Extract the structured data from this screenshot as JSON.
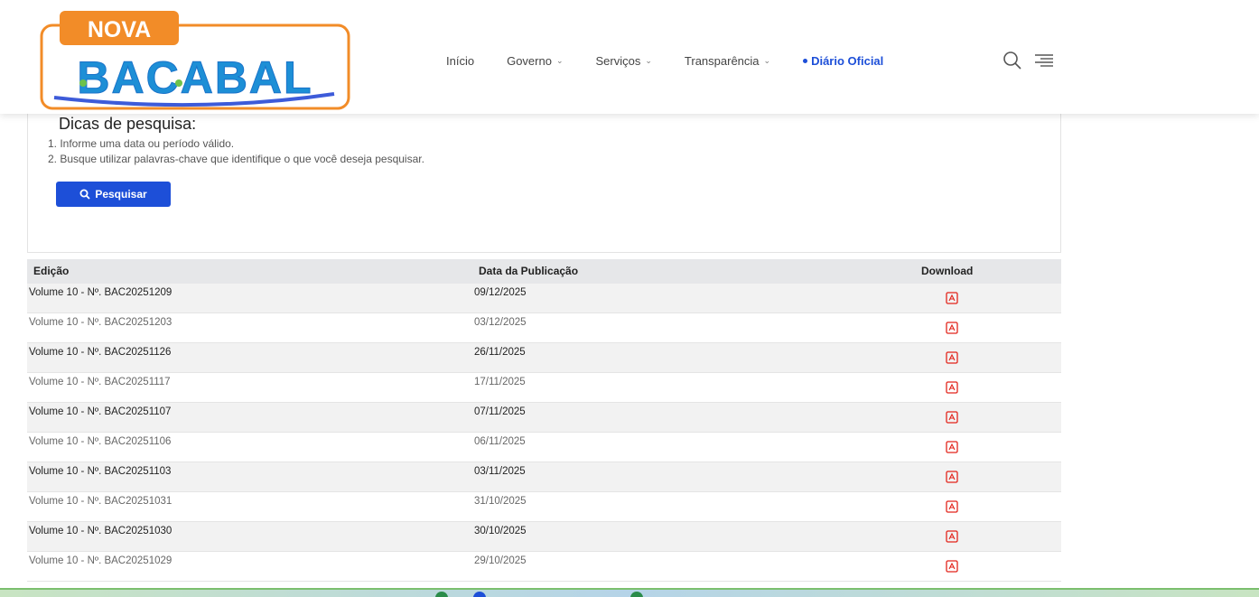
{
  "brand": {
    "logo_top": "NOVA",
    "logo_bottom": "BACABAL"
  },
  "nav": [
    {
      "label": "Início",
      "dropdown": false
    },
    {
      "label": "Governo",
      "dropdown": true
    },
    {
      "label": "Serviços",
      "dropdown": true
    },
    {
      "label": "Transparência",
      "dropdown": true
    },
    {
      "label": "Diário Oficial",
      "dropdown": false,
      "active": true
    }
  ],
  "colors": {
    "accent": "#1d4fd8",
    "logo_orange": "#f28c28",
    "pdf_red": "#e2231a"
  },
  "tips": {
    "title": "Dicas de pesquisa:",
    "items": [
      "1. Informe uma data ou período válido.",
      "2. Busque utilizar palavras-chave que identifique o que você deseja pesquisar."
    ],
    "search_button": "Pesquisar"
  },
  "table": {
    "headers": {
      "edition": "Edição",
      "date": "Data da Publicação",
      "download": "Download"
    },
    "rows": [
      {
        "edition": "Volume 10 - Nº. BAC20251209",
        "date": "09/12/2025"
      },
      {
        "edition": "Volume 10 - Nº. BAC20251203",
        "date": "03/12/2025"
      },
      {
        "edition": "Volume 10 - Nº. BAC20251126",
        "date": "26/11/2025"
      },
      {
        "edition": "Volume 10 - Nº. BAC20251117",
        "date": "17/11/2025"
      },
      {
        "edition": "Volume 10 - Nº. BAC20251107",
        "date": "07/11/2025"
      },
      {
        "edition": "Volume 10 - Nº. BAC20251106",
        "date": "06/11/2025"
      },
      {
        "edition": "Volume 10 - Nº. BAC20251103",
        "date": "03/11/2025"
      },
      {
        "edition": "Volume 10 - Nº. BAC20251031",
        "date": "31/10/2025"
      },
      {
        "edition": "Volume 10 - Nº. BAC20251030",
        "date": "30/10/2025"
      },
      {
        "edition": "Volume 10 - Nº. BAC20251029",
        "date": "29/10/2025"
      }
    ]
  }
}
